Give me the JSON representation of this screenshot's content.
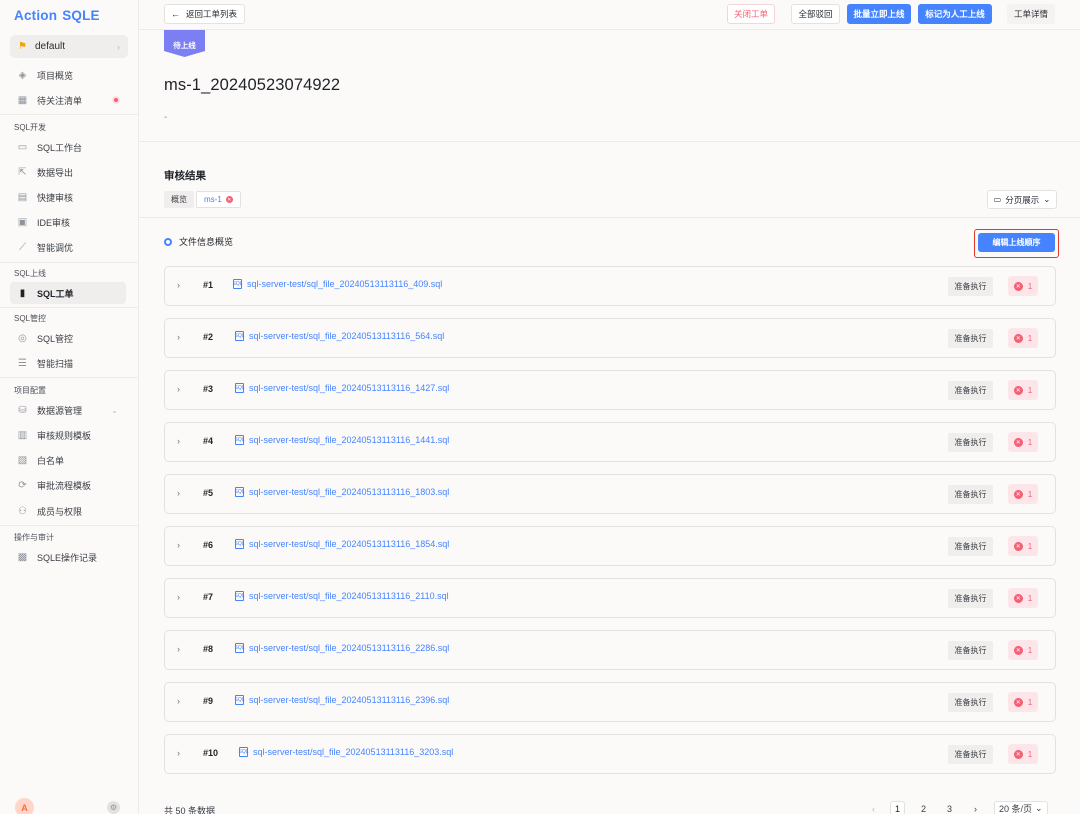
{
  "brand": {
    "part1": "Action",
    "part2": "SQLE"
  },
  "project": {
    "name": "default"
  },
  "nav": {
    "overview": "项目概览",
    "todo": "待关注清单",
    "group_dev": "SQL开发",
    "workbench": "SQL工作台",
    "export": "数据导出",
    "quick_audit": "快捷审核",
    "ide_audit": "IDE审核",
    "tuning": "智能调优",
    "group_release": "SQL上线",
    "workorder": "SQL工单",
    "group_control": "SQL管控",
    "sql_control": "SQL管控",
    "smart_scan": "智能扫描",
    "group_config": "项目配置",
    "datasource": "数据源管理",
    "rule_template": "审核规则模板",
    "whitelist": "白名单",
    "flow_template": "审批流程模板",
    "members": "成员与权限",
    "group_audit": "操作与审计",
    "op_records": "SQLE操作记录"
  },
  "avatar": {
    "initial": "A"
  },
  "topbar": {
    "back": "返回工单列表",
    "close": "关闭工单",
    "reject_all": "全部驳回",
    "batch_release": "批量立即上线",
    "mark_manual": "标记为人工上线",
    "detail": "工单详情"
  },
  "workorder": {
    "status_tag": "待上线",
    "title": "ms-1_20240523074922",
    "desc": "-"
  },
  "audit": {
    "section_title": "审核结果",
    "tab_overview": "概览",
    "tab_datasource": "ms-1",
    "paging_toggle": "分页展示",
    "file_info_title": "文件信息概览",
    "edit_order": "编辑上线顺序"
  },
  "files": [
    {
      "index": "#1",
      "name": "sql-server-test/sql_file_20240513113116_409.sql",
      "status": "准备执行",
      "errors": "1"
    },
    {
      "index": "#2",
      "name": "sql-server-test/sql_file_20240513113116_564.sql",
      "status": "准备执行",
      "errors": "1"
    },
    {
      "index": "#3",
      "name": "sql-server-test/sql_file_20240513113116_1427.sql",
      "status": "准备执行",
      "errors": "1"
    },
    {
      "index": "#4",
      "name": "sql-server-test/sql_file_20240513113116_1441.sql",
      "status": "准备执行",
      "errors": "1"
    },
    {
      "index": "#5",
      "name": "sql-server-test/sql_file_20240513113116_1803.sql",
      "status": "准备执行",
      "errors": "1"
    },
    {
      "index": "#6",
      "name": "sql-server-test/sql_file_20240513113116_1854.sql",
      "status": "准备执行",
      "errors": "1"
    },
    {
      "index": "#7",
      "name": "sql-server-test/sql_file_20240513113116_2110.sql",
      "status": "准备执行",
      "errors": "1"
    },
    {
      "index": "#8",
      "name": "sql-server-test/sql_file_20240513113116_2286.sql",
      "status": "准备执行",
      "errors": "1"
    },
    {
      "index": "#9",
      "name": "sql-server-test/sql_file_20240513113116_2396.sql",
      "status": "准备执行",
      "errors": "1"
    },
    {
      "index": "#10",
      "name": "sql-server-test/sql_file_20240513113116_3203.sql",
      "status": "准备执行",
      "errors": "1"
    }
  ],
  "pagination": {
    "total": "共 50 条数据",
    "pages": [
      "1",
      "2",
      "3"
    ],
    "current": "1",
    "page_size": "20 条/页"
  },
  "colors": {
    "primary": "#4583ff",
    "danger": "#f66074",
    "tag": "#7b7ff3",
    "highlight": "#e53a2a"
  }
}
